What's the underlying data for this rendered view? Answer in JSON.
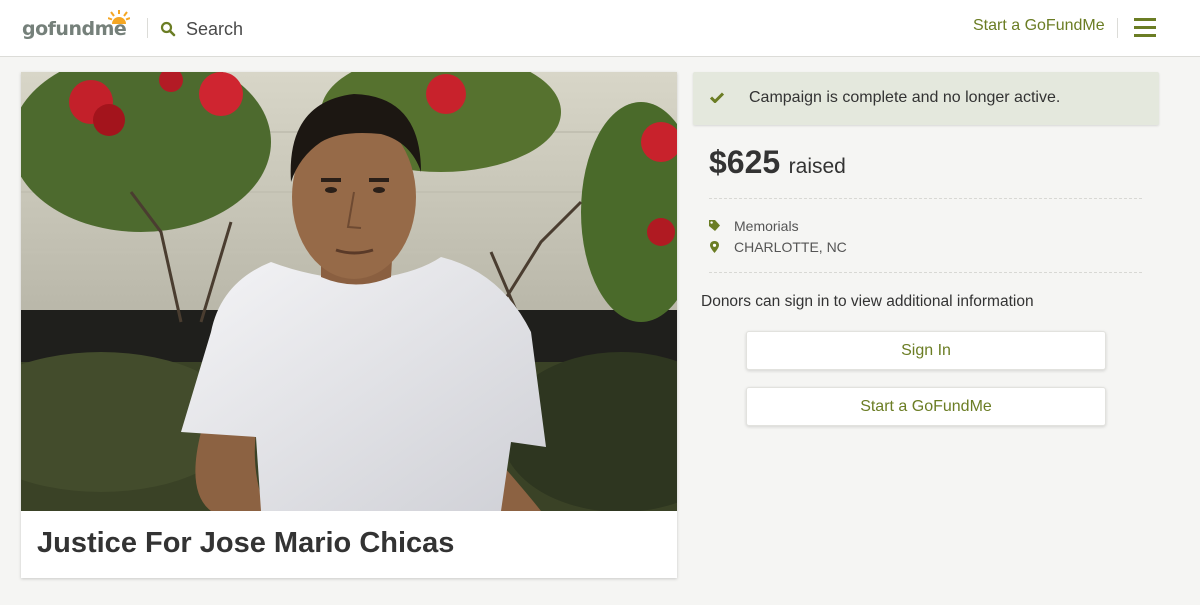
{
  "header": {
    "logo_text": "gofundme",
    "search_label": "Search",
    "start_link": "Start a GoFundMe"
  },
  "campaign": {
    "title": "Justice For Jose Mario Chicas"
  },
  "sidebar": {
    "status_text": "Campaign is complete and no longer active.",
    "raised_amount": "$625",
    "raised_label": "raised",
    "category": "Memorials",
    "location": "CHARLOTTE, NC",
    "donors_text": "Donors can sign in to view additional information",
    "sign_in_button": "Sign In",
    "start_button": "Start a GoFundMe"
  },
  "colors": {
    "brand_green": "#6b7d24",
    "status_background": "#e4e8dd",
    "logo_sun": "#f5a623"
  },
  "icons": [
    "search-icon",
    "menu-icon",
    "check-icon",
    "tag-icon",
    "location-pin-icon"
  ]
}
